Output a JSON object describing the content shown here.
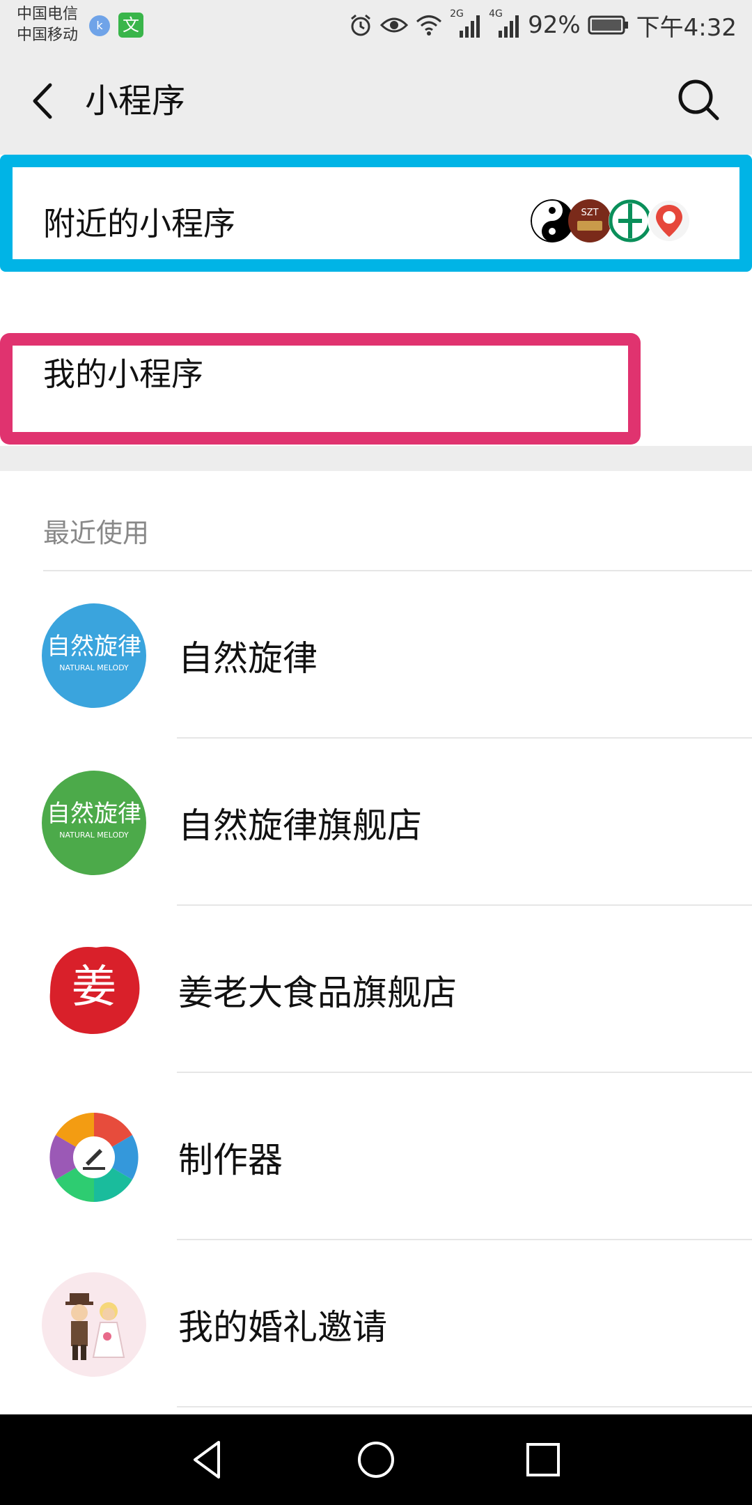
{
  "status_bar": {
    "carrier_1": "中国电信",
    "carrier_2": "中国移动",
    "badge_1": "k",
    "badge_2": "文",
    "net_2g": "2G",
    "net_4g": "4G",
    "battery": "92%",
    "time": "下午4:32"
  },
  "header": {
    "title": "小程序"
  },
  "nearby": {
    "label": "附近的小程序",
    "icons": [
      "taiji-icon",
      "szt-logo-icon",
      "bank-logo-icon",
      "location-pin-icon"
    ],
    "szt_text": "SZT",
    "highlight_color": "#00b4e6"
  },
  "mine": {
    "label": "我的小程序",
    "highlight_color": "#e0336f"
  },
  "recent": {
    "header": "最近使用",
    "items": [
      {
        "label": "自然旋律",
        "icon_text": "自然旋律",
        "icon_sub": "NATURAL MELODY",
        "color": "#3aa4dd"
      },
      {
        "label": "自然旋律旗舰店",
        "icon_text": "自然旋律",
        "icon_sub": "NATURAL MELODY",
        "color": "#4caa4a"
      },
      {
        "label": "姜老大食品旗舰店",
        "icon_text": "姜",
        "color": "#d9202a"
      },
      {
        "label": "制作器",
        "color": "#f39c12"
      },
      {
        "label": "我的婚礼邀请",
        "color": "#f9e8ec"
      }
    ]
  }
}
